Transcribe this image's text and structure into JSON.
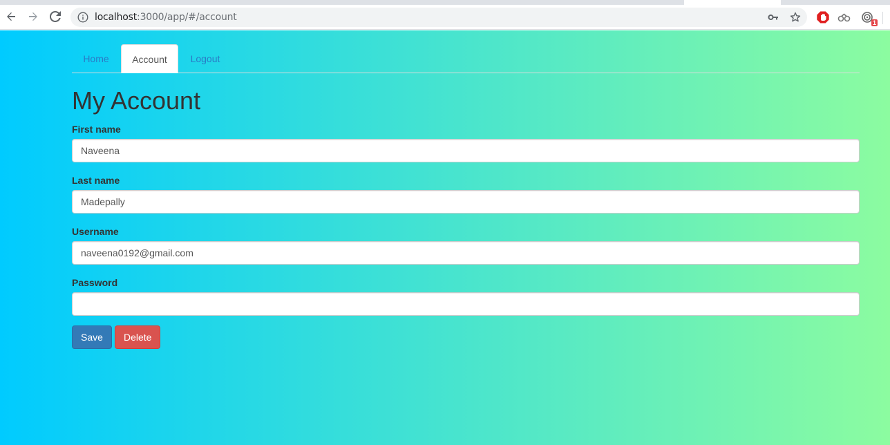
{
  "browser": {
    "url_host": "localhost",
    "url_path": ":3000/app/#/account",
    "extension_badge": "1"
  },
  "nav": {
    "tabs": [
      {
        "label": "Home"
      },
      {
        "label": "Account"
      },
      {
        "label": "Logout"
      }
    ],
    "active_tab": "Account"
  },
  "page": {
    "title": "My Account"
  },
  "form": {
    "first_name": {
      "label": "First name",
      "value": "Naveena"
    },
    "last_name": {
      "label": "Last name",
      "value": "Madepally"
    },
    "username": {
      "label": "Username",
      "value": "naveena0192@gmail.com"
    },
    "password": {
      "label": "Password",
      "value": ""
    },
    "save_label": "Save",
    "delete_label": "Delete"
  },
  "colors": {
    "gradient_start": "#00cbff",
    "gradient_end": "#8cfca0",
    "primary": "#337ab7",
    "danger": "#d9534f",
    "link": "#2a7cc6"
  }
}
